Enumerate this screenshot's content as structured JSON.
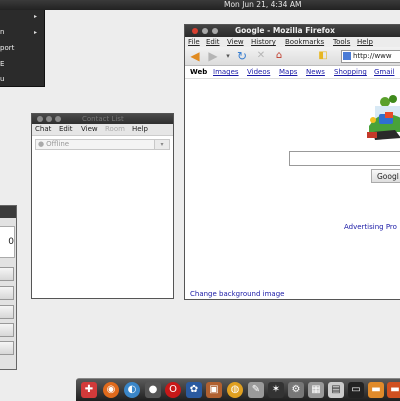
{
  "topbar": {
    "clock": "Mon Jun 21,  4:34 AM"
  },
  "app_menu": {
    "items": [
      "n",
      "port",
      "E",
      "u"
    ]
  },
  "contact_list": {
    "title": "Contact List",
    "menu": [
      "Chat",
      "Edit",
      "View",
      "Room",
      "Help"
    ],
    "status": "Offline"
  },
  "firefox": {
    "title": "Google - Mozilla Firefox",
    "menu": [
      "File",
      "Edit",
      "View",
      "History",
      "Bookmarks",
      "Tools",
      "Help"
    ],
    "url": "http://www",
    "google_nav": [
      "Web",
      "Images",
      "Videos",
      "Maps",
      "News",
      "Shopping",
      "Gmail"
    ],
    "search_button": "Googl",
    "advertising": "Advertising Pro",
    "change_bg": "Change background image"
  },
  "calculator": {
    "display": "0"
  },
  "colors": {
    "topbar": "#2a2a2a",
    "link": "#1a1aa6",
    "close": "#d84030",
    "minimize": "#b0b0b0"
  }
}
